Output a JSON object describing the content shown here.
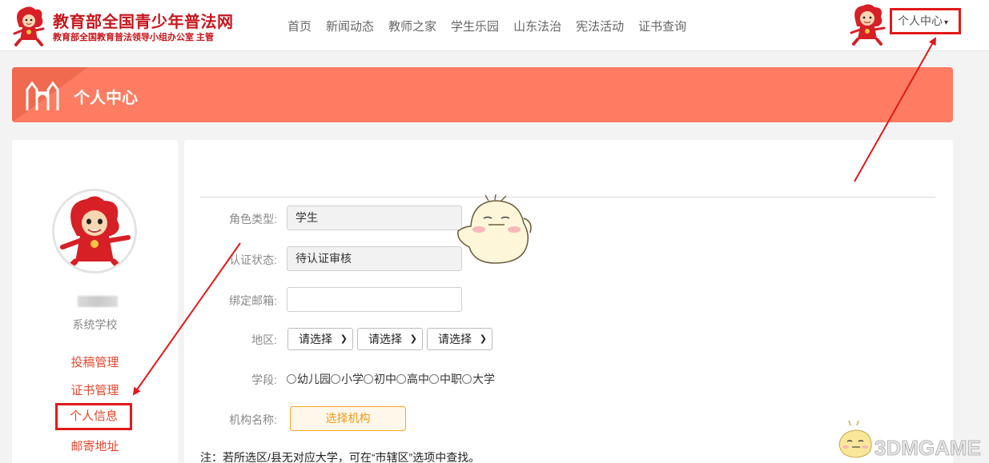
{
  "header": {
    "site_title": "教育部全国青少年普法网",
    "site_subtitle": "教育部全国教育普法领导小组办公室 主管",
    "nav": [
      "首页",
      "新闻动态",
      "教师之家",
      "学生乐园",
      "山东法治",
      "宪法活动",
      "证书查询"
    ],
    "user_center": "个人中心",
    "caret": "▾"
  },
  "banner": {
    "title": "个人中心"
  },
  "sidebar": {
    "school": "系统学校",
    "links": [
      "投稿管理",
      "证书管理",
      "个人信息",
      "邮寄地址"
    ]
  },
  "form": {
    "role_label": "角色类型:",
    "role_value": "学生",
    "cert_label": "认证状态:",
    "cert_value": "待认证审核",
    "email_label": "绑定邮箱:",
    "email_value": "",
    "region_label": "地区:",
    "region_selects": [
      "请选择",
      "请选择",
      "请选择"
    ],
    "stage_label": "学段:",
    "stages": [
      "幼儿园",
      "小学",
      "初中",
      "高中",
      "中职",
      "大学"
    ],
    "org_label": "机构名称:",
    "org_button": "选择机构",
    "note": "注：若所选区/县无对应大学，可在“市辖区”选项中查找。"
  },
  "watermark": {
    "text": "3DMGAME"
  },
  "colors": {
    "brand_red": "#c8161d",
    "banner": "#fe7c61",
    "link": "#e8472d",
    "highlight": "#e21a1a",
    "org_button": "#f19a17"
  }
}
